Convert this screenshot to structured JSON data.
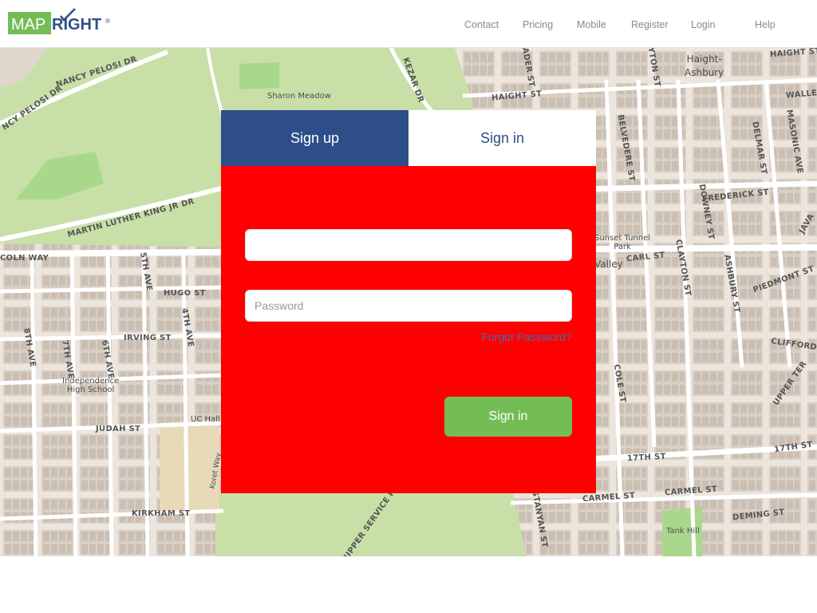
{
  "header": {
    "logo": {
      "text_left": "MAP",
      "text_right": "RIGHT",
      "mark": "®",
      "icon": "checkmark-icon"
    },
    "nav": [
      {
        "label": "Contact"
      },
      {
        "label": "Pricing"
      },
      {
        "label": "Mobile"
      },
      {
        "label": "Register"
      },
      {
        "label": "Login"
      },
      {
        "label": "Help"
      }
    ]
  },
  "map": {
    "labels": {
      "haight_ashbury": "Haight-\nAshbury",
      "sharon_meadow": "Sharon Meadow",
      "nancy_pelosi_1": "NANCY PELOSI DR",
      "nancy_pelosi_2": "NCY PELOSI DR",
      "kezar": "KEZAR DR",
      "haight_st_1": "HAIGHT ST",
      "haight_st_2": "HAIGHT ST",
      "martin_luther": "MARTIN LUTHER KING JR DR",
      "lincoln": "COLN WAY",
      "hugo": "HUGO ST",
      "irving": "IRVING ST",
      "judah": "JUDAH ST",
      "kirkham": "KIRKHAM ST",
      "independence": "Independence\nHigh School",
      "uc_hall": "UC Hall",
      "frederick": "FREDERICK ST",
      "carl": "CARL ST",
      "sunset_tunnel": "Sunset Tunnel\nPark",
      "valley": "Valley",
      "piedmont": "PIEDMONT ST",
      "clifford": "CLIFFORD TER",
      "upper_ter": "UPPER TER",
      "st17_1": "17TH ST",
      "st17_2": "17TH ST",
      "carmel_1": "CARMEL ST",
      "carmel_2": "CARMEL ST",
      "deming": "DEMING ST",
      "tank_hill": "Tank Hill",
      "upper_service": "UPPER SERVICE RD",
      "belvedere": "BELVEDERE ST",
      "ashbury": "ASHBURY ST",
      "delmar": "DELMAR ST",
      "masonic": "MASONIC AVE",
      "downey": "DOWNEY ST",
      "clayton": "CLAYTON ST",
      "cole": "COLE ST",
      "wallen": "WALLE",
      "java": "JAVA",
      "ave_8": "8TH AVE",
      "ave_7": "7TH AVE",
      "ave_6": "6TH AVE",
      "ave_5": "5TH AVE",
      "ave_4": "4TH AVE",
      "koret": "Koret Way",
      "stanyan": "STANYAN ST",
      "ayton": "AYTON ST",
      "rader": "RADER ST"
    }
  },
  "auth": {
    "tabs": {
      "signup": "Sign up",
      "signin": "Sign in"
    },
    "email": {
      "value": "",
      "placeholder": ""
    },
    "password": {
      "value": "",
      "placeholder": "Password"
    },
    "forgot_label": "Forgot Password?",
    "submit_label": "Sign in"
  },
  "colors": {
    "tab_active": "#2d4e89",
    "form_bg": "#ff0000",
    "button": "#74bd56",
    "logo_green": "#74bd56",
    "logo_blue": "#2d4e89",
    "park": "#c8dfa8"
  }
}
